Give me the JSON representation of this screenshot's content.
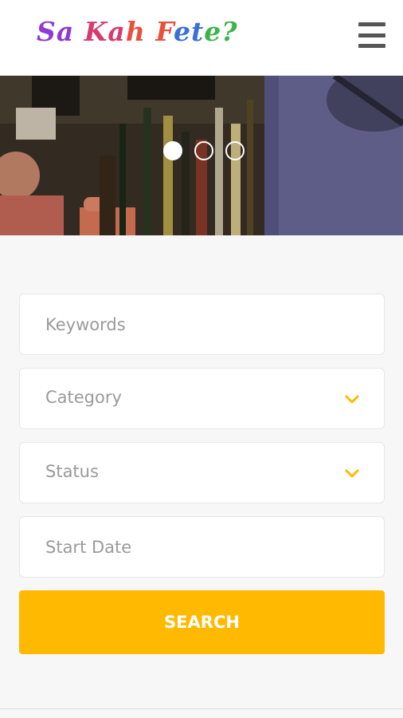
{
  "header": {
    "logo": {
      "text": "Sa Kah Fete?",
      "colors": [
        "#8e3bd6",
        "#d63b6e",
        "#e8503a",
        "#3b6ed6",
        "#3bb54a",
        "#e6d23b"
      ]
    },
    "menu_icon": "hamburger-icon"
  },
  "hero": {
    "slides": 3,
    "active_slide": 1
  },
  "form": {
    "keywords_placeholder": "Keywords",
    "category_label": "Category",
    "status_label": "Status",
    "start_date_placeholder": "Start Date",
    "search_label": "SEARCH",
    "accent": "#ffba00",
    "chevron_icon": "chevron-down-icon"
  }
}
